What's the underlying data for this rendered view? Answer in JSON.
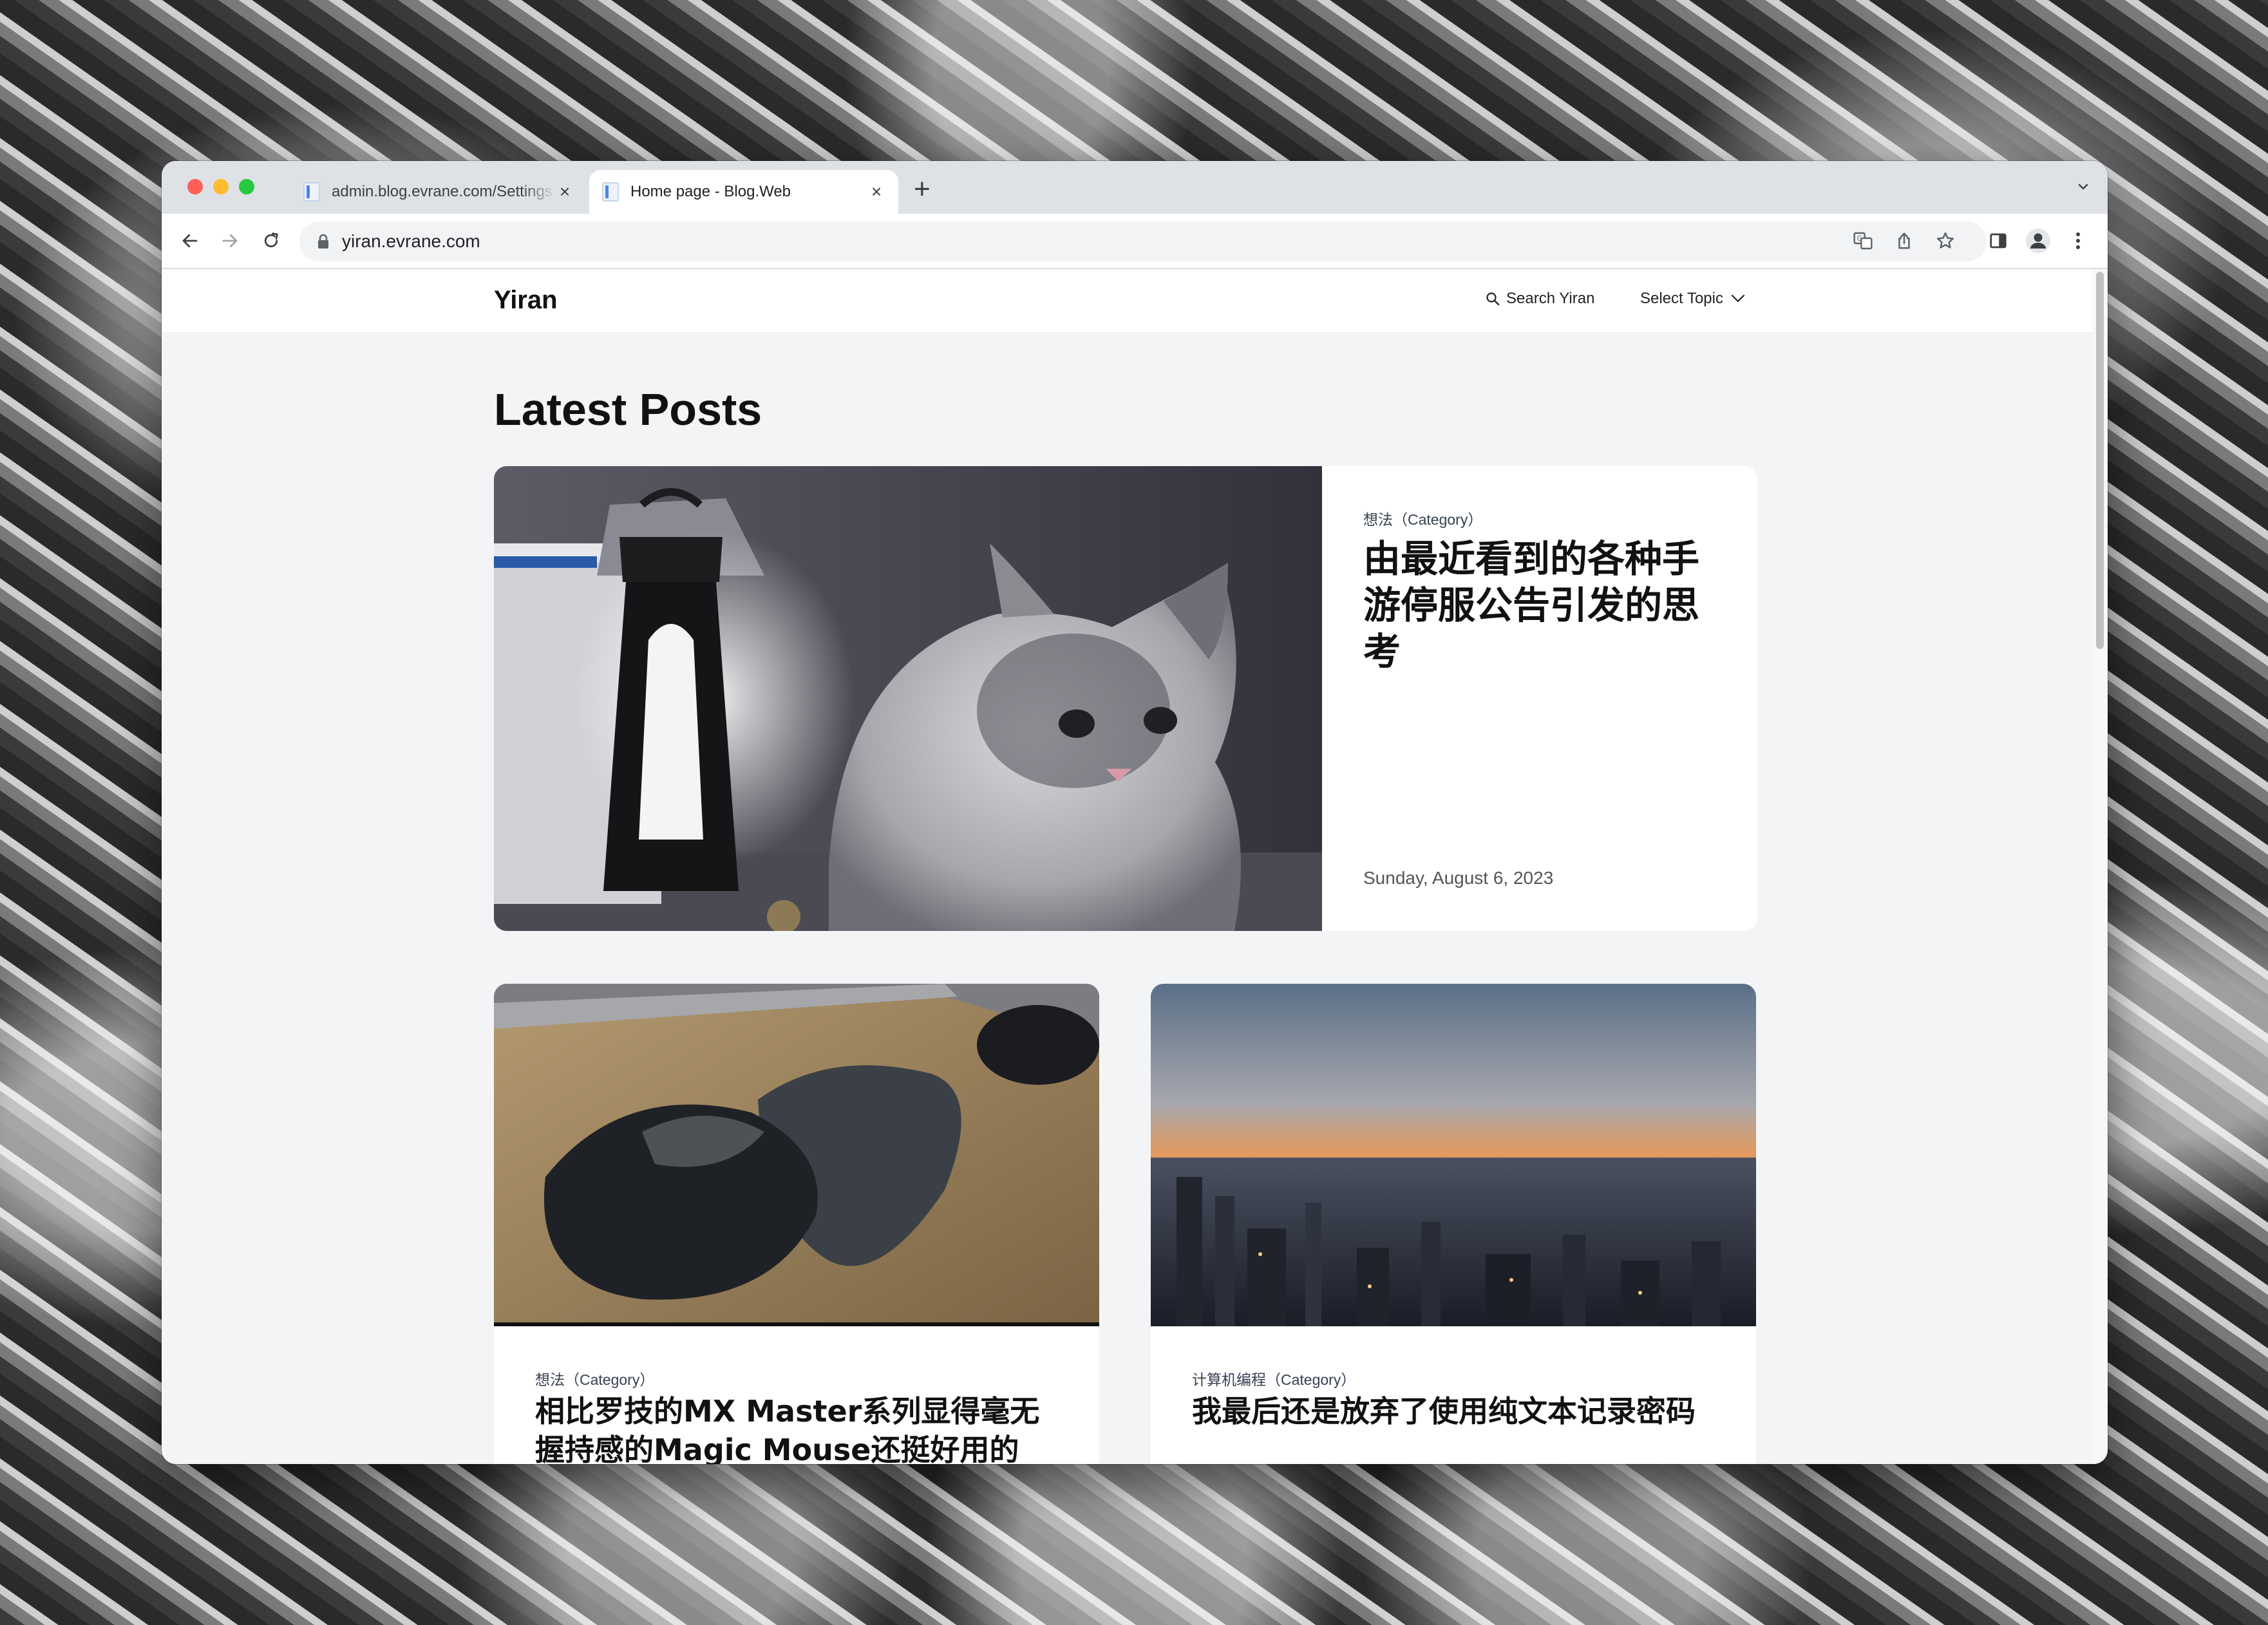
{
  "browser": {
    "tabs": [
      {
        "title": "admin.blog.evrane.com/Settings",
        "close": "×",
        "active": false
      },
      {
        "title": "Home page - Blog.Web",
        "close": "×",
        "active": true
      }
    ],
    "new_tab": "+",
    "url": "yiran.evrane.com"
  },
  "site": {
    "brand": "Yiran",
    "search_label": "Search Yiran",
    "topic_label": "Select Topic"
  },
  "main": {
    "heading": "Latest Posts",
    "featured": {
      "category": "想法（Category）",
      "title": "由最近看到的各种手游停服公告引发的思考",
      "date": "Sunday, August 6, 2023"
    },
    "cards": [
      {
        "category": "想法（Category）",
        "title": "相比罗技的MX Master系列显得毫无握持感的Magic Mouse还挺好用的"
      },
      {
        "category": "计算机编程（Category）",
        "title": "我最后还是放弃了使用纯文本记录密码"
      }
    ]
  },
  "colors": {
    "tab_strip": "#dee1e6",
    "page_background": "#f3f4f6",
    "close_button": "#ff5f57",
    "minimize_button": "#febc2e",
    "maximize_button": "#28c840"
  },
  "icons": [
    "back-arrow-icon",
    "forward-arrow-icon",
    "reload-icon",
    "lock-icon",
    "translate-icon",
    "share-icon",
    "star-icon",
    "side-panel-icon",
    "profile-icon",
    "more-vert-icon",
    "search-icon",
    "chevron-down-icon"
  ]
}
